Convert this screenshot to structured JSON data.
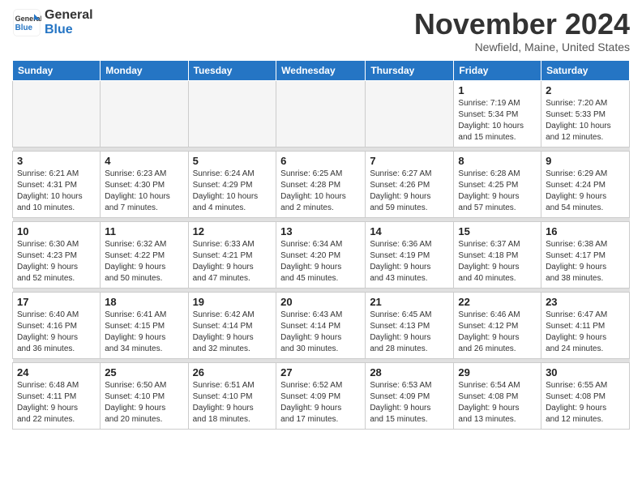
{
  "header": {
    "logo_general": "General",
    "logo_blue": "Blue",
    "month_title": "November 2024",
    "location": "Newfield, Maine, United States"
  },
  "weekdays": [
    "Sunday",
    "Monday",
    "Tuesday",
    "Wednesday",
    "Thursday",
    "Friday",
    "Saturday"
  ],
  "weeks": [
    [
      {
        "day": "",
        "info": ""
      },
      {
        "day": "",
        "info": ""
      },
      {
        "day": "",
        "info": ""
      },
      {
        "day": "",
        "info": ""
      },
      {
        "day": "",
        "info": ""
      },
      {
        "day": "1",
        "info": "Sunrise: 7:19 AM\nSunset: 5:34 PM\nDaylight: 10 hours\nand 15 minutes."
      },
      {
        "day": "2",
        "info": "Sunrise: 7:20 AM\nSunset: 5:33 PM\nDaylight: 10 hours\nand 12 minutes."
      }
    ],
    [
      {
        "day": "3",
        "info": "Sunrise: 6:21 AM\nSunset: 4:31 PM\nDaylight: 10 hours\nand 10 minutes."
      },
      {
        "day": "4",
        "info": "Sunrise: 6:23 AM\nSunset: 4:30 PM\nDaylight: 10 hours\nand 7 minutes."
      },
      {
        "day": "5",
        "info": "Sunrise: 6:24 AM\nSunset: 4:29 PM\nDaylight: 10 hours\nand 4 minutes."
      },
      {
        "day": "6",
        "info": "Sunrise: 6:25 AM\nSunset: 4:28 PM\nDaylight: 10 hours\nand 2 minutes."
      },
      {
        "day": "7",
        "info": "Sunrise: 6:27 AM\nSunset: 4:26 PM\nDaylight: 9 hours\nand 59 minutes."
      },
      {
        "day": "8",
        "info": "Sunrise: 6:28 AM\nSunset: 4:25 PM\nDaylight: 9 hours\nand 57 minutes."
      },
      {
        "day": "9",
        "info": "Sunrise: 6:29 AM\nSunset: 4:24 PM\nDaylight: 9 hours\nand 54 minutes."
      }
    ],
    [
      {
        "day": "10",
        "info": "Sunrise: 6:30 AM\nSunset: 4:23 PM\nDaylight: 9 hours\nand 52 minutes."
      },
      {
        "day": "11",
        "info": "Sunrise: 6:32 AM\nSunset: 4:22 PM\nDaylight: 9 hours\nand 50 minutes."
      },
      {
        "day": "12",
        "info": "Sunrise: 6:33 AM\nSunset: 4:21 PM\nDaylight: 9 hours\nand 47 minutes."
      },
      {
        "day": "13",
        "info": "Sunrise: 6:34 AM\nSunset: 4:20 PM\nDaylight: 9 hours\nand 45 minutes."
      },
      {
        "day": "14",
        "info": "Sunrise: 6:36 AM\nSunset: 4:19 PM\nDaylight: 9 hours\nand 43 minutes."
      },
      {
        "day": "15",
        "info": "Sunrise: 6:37 AM\nSunset: 4:18 PM\nDaylight: 9 hours\nand 40 minutes."
      },
      {
        "day": "16",
        "info": "Sunrise: 6:38 AM\nSunset: 4:17 PM\nDaylight: 9 hours\nand 38 minutes."
      }
    ],
    [
      {
        "day": "17",
        "info": "Sunrise: 6:40 AM\nSunset: 4:16 PM\nDaylight: 9 hours\nand 36 minutes."
      },
      {
        "day": "18",
        "info": "Sunrise: 6:41 AM\nSunset: 4:15 PM\nDaylight: 9 hours\nand 34 minutes."
      },
      {
        "day": "19",
        "info": "Sunrise: 6:42 AM\nSunset: 4:14 PM\nDaylight: 9 hours\nand 32 minutes."
      },
      {
        "day": "20",
        "info": "Sunrise: 6:43 AM\nSunset: 4:14 PM\nDaylight: 9 hours\nand 30 minutes."
      },
      {
        "day": "21",
        "info": "Sunrise: 6:45 AM\nSunset: 4:13 PM\nDaylight: 9 hours\nand 28 minutes."
      },
      {
        "day": "22",
        "info": "Sunrise: 6:46 AM\nSunset: 4:12 PM\nDaylight: 9 hours\nand 26 minutes."
      },
      {
        "day": "23",
        "info": "Sunrise: 6:47 AM\nSunset: 4:11 PM\nDaylight: 9 hours\nand 24 minutes."
      }
    ],
    [
      {
        "day": "24",
        "info": "Sunrise: 6:48 AM\nSunset: 4:11 PM\nDaylight: 9 hours\nand 22 minutes."
      },
      {
        "day": "25",
        "info": "Sunrise: 6:50 AM\nSunset: 4:10 PM\nDaylight: 9 hours\nand 20 minutes."
      },
      {
        "day": "26",
        "info": "Sunrise: 6:51 AM\nSunset: 4:10 PM\nDaylight: 9 hours\nand 18 minutes."
      },
      {
        "day": "27",
        "info": "Sunrise: 6:52 AM\nSunset: 4:09 PM\nDaylight: 9 hours\nand 17 minutes."
      },
      {
        "day": "28",
        "info": "Sunrise: 6:53 AM\nSunset: 4:09 PM\nDaylight: 9 hours\nand 15 minutes."
      },
      {
        "day": "29",
        "info": "Sunrise: 6:54 AM\nSunset: 4:08 PM\nDaylight: 9 hours\nand 13 minutes."
      },
      {
        "day": "30",
        "info": "Sunrise: 6:55 AM\nSunset: 4:08 PM\nDaylight: 9 hours\nand 12 minutes."
      }
    ]
  ]
}
